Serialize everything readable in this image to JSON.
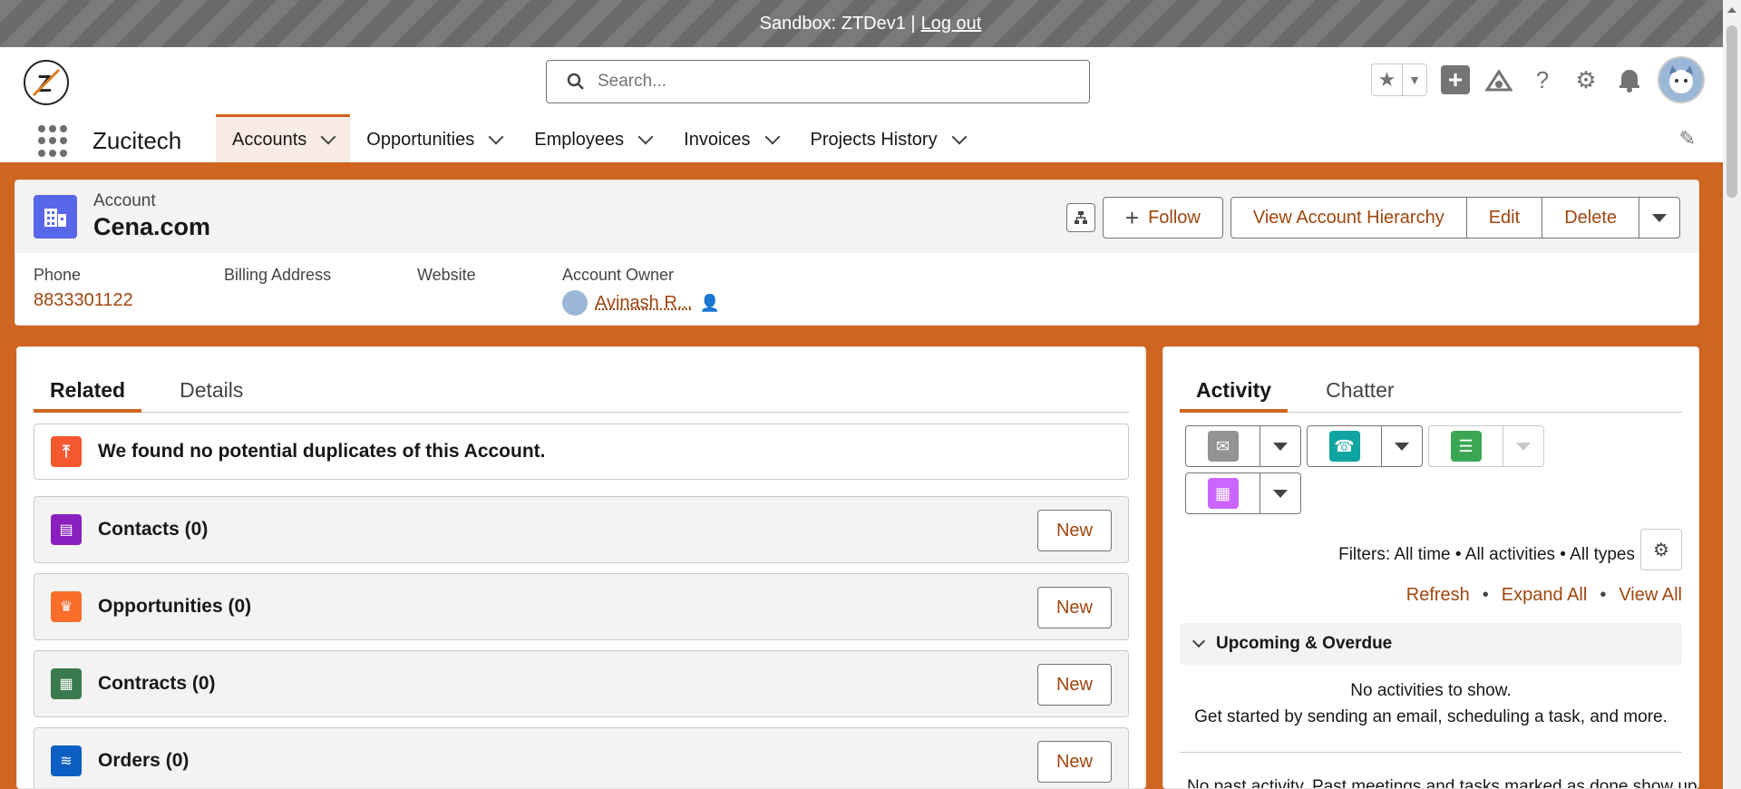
{
  "sandbox": {
    "text": "Sandbox: ZTDev1 |",
    "logout": "Log out"
  },
  "header": {
    "search_placeholder": "Search...",
    "logo_text": "Z"
  },
  "nav": {
    "app_name": "Zucitech",
    "items": [
      {
        "label": "Accounts",
        "active": true
      },
      {
        "label": "Opportunities"
      },
      {
        "label": "Employees"
      },
      {
        "label": "Invoices"
      },
      {
        "label": "Projects History"
      }
    ]
  },
  "record": {
    "object_type": "Account",
    "name": "Cena.com",
    "actions": {
      "follow": "Follow",
      "hierarchy": "View Account Hierarchy",
      "edit": "Edit",
      "delete": "Delete"
    },
    "fields": {
      "phone_label": "Phone",
      "phone_value": "8833301122",
      "billing_label": "Billing Address",
      "website_label": "Website",
      "owner_label": "Account Owner",
      "owner_value": "Avinash R..."
    }
  },
  "related": {
    "tabs": [
      "Related",
      "Details"
    ],
    "duplicates_message": "We found no potential duplicates of this Account.",
    "cards": [
      {
        "title": "Contacts (0)",
        "icon": "contact-card-icon",
        "color": "#8a1fbf",
        "new_label": "New"
      },
      {
        "title": "Opportunities (0)",
        "icon": "crown-icon",
        "color": "#fb6d2a",
        "new_label": "New"
      },
      {
        "title": "Contracts (0)",
        "icon": "contract-icon",
        "color": "#3b7a4e",
        "new_label": "New"
      },
      {
        "title": "Orders (0)",
        "icon": "orders-stack-icon",
        "color": "#0c5fc2",
        "new_label": "New"
      }
    ]
  },
  "activity": {
    "tabs": [
      "Activity",
      "Chatter"
    ],
    "filters": "Filters: All time • All activities • All types",
    "links": {
      "refresh": "Refresh",
      "expand_all": "Expand All",
      "view_all": "View All",
      "separator": "•"
    },
    "upcoming_title": "Upcoming & Overdue",
    "empty_line1": "No activities to show.",
    "empty_line2": "Get started by sending an email, scheduling a task, and more.",
    "past_text": "No past activity. Past meetings and tasks marked as done show up here."
  },
  "colors": {
    "brand": "#cf651f",
    "link": "#a0460f",
    "account_icon": "#5867e8"
  }
}
